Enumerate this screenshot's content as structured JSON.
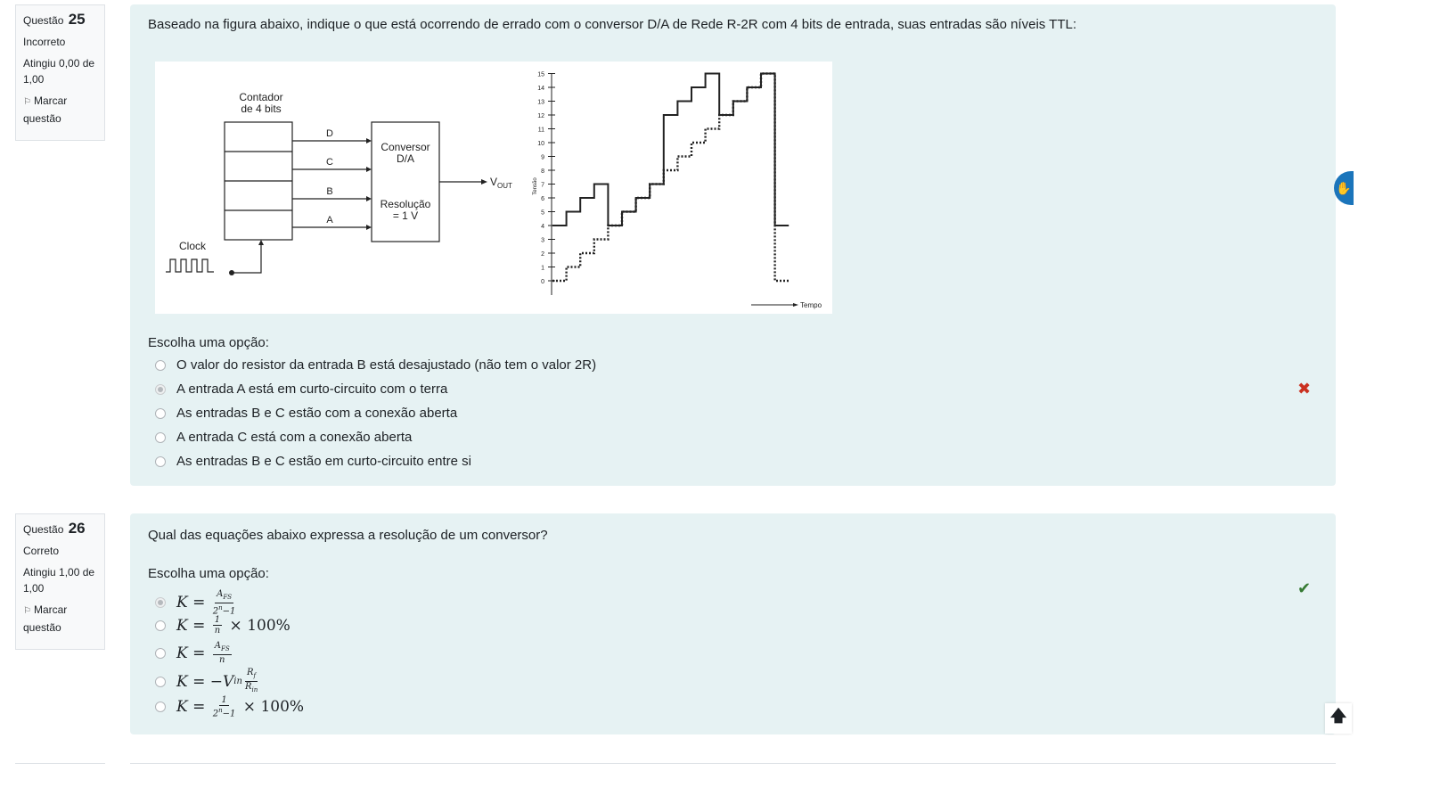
{
  "questions": [
    {
      "number_label": "Questão",
      "number": "25",
      "state": "Incorreto",
      "grade": "Atingiu 0,00 de 1,00",
      "flag_label": "Marcar questão",
      "text": "Baseado na figura abaixo, indique o que está ocorrendo de errado com o conversor D/A de Rede R-2R com 4 bits de entrada, suas entradas são níveis TTL:",
      "prompt": "Escolha uma opção:",
      "options": [
        "O valor do resistor da entrada B está desajustado (não tem o valor 2R)",
        "A entrada A está em curto-circuito com o terra",
        "As entradas B e C estão com a conexão aberta",
        "A entrada C está com a conexão aberta",
        "As entradas B e C estão em curto-circuito entre si"
      ],
      "selected_index": 1,
      "result_icon": "cross-icon",
      "figure": {
        "counter_label_1": "Contador",
        "counter_label_2": "de 4 bits",
        "inputs": [
          "D",
          "C",
          "B",
          "A"
        ],
        "clock_label": "Clock",
        "converter_label_1": "Conversor",
        "converter_label_2": "D/A",
        "resolution_label_1": "Resolução",
        "resolution_label_2": "= 1 V",
        "vout_main": "V",
        "vout_sub": "OUT",
        "y_axis_label": "Tensão",
        "x_axis_label": "Tempo",
        "y_ticks": [
          "0",
          "1",
          "2",
          "3",
          "4",
          "5",
          "6",
          "7",
          "8",
          "9",
          "10",
          "11",
          "12",
          "13",
          "14",
          "15"
        ],
        "expected_steps": [
          0,
          1,
          2,
          3,
          4,
          5,
          6,
          7,
          8,
          9,
          10,
          11,
          12,
          13,
          14,
          15,
          0
        ],
        "observed_steps": [
          4,
          5,
          6,
          7,
          4,
          5,
          6,
          7,
          12,
          13,
          14,
          15,
          12,
          13,
          14,
          15,
          4
        ]
      }
    },
    {
      "number_label": "Questão",
      "number": "26",
      "state": "Correto",
      "grade": "Atingiu 1,00 de 1,00",
      "flag_label": "Marcar questão",
      "text": "Qual das equações abaixo expressa a resolução de um conversor?",
      "prompt": "Escolha uma opção:",
      "selected_index": 0,
      "result_icon": "check-icon",
      "options_math": [
        {
          "lhs": "K",
          "num": "A_FS",
          "den": "2^n−1",
          "suffix": ""
        },
        {
          "lhs": "K",
          "num": "1",
          "den": "n",
          "suffix": "× 100%"
        },
        {
          "lhs": "K",
          "num": "A_FS",
          "den": "n",
          "suffix": ""
        },
        {
          "lhs": "K",
          "prefix": "−V_in",
          "num": "R_f",
          "den": "R_in",
          "suffix": ""
        },
        {
          "lhs": "K",
          "num": "1",
          "den": "2^n−1",
          "suffix": "× 100%"
        }
      ]
    }
  ],
  "icons": {
    "flag": "flag-icon",
    "back_to_top": "arrow-up-icon",
    "accessibility": "hand-icon"
  },
  "colors": {
    "card_bg": "#e6f2f3",
    "incorrect": "#ca3120",
    "correct": "#357a32",
    "accessibility": "#1b75bb"
  }
}
